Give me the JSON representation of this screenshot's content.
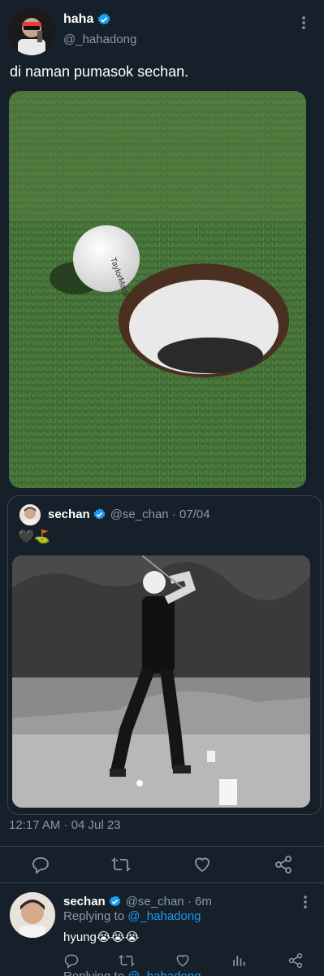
{
  "tweet": {
    "author_name": "haha",
    "author_handle": "@_hahadong",
    "text": "di naman pumasok sechan.",
    "media_alt": "golf ball at the edge of a hole",
    "timestamp": "12:17 AM · 04 Jul 23"
  },
  "quote": {
    "author_name": "sechan",
    "author_handle": "@se_chan",
    "date": "07/04",
    "text": "🖤⛳",
    "media_alt": "black and white photo of golfer mid-swing"
  },
  "reply": {
    "author_name": "sechan",
    "author_handle": "@se_chan",
    "time": "6m",
    "replying_label": "Replying to",
    "replying_handle": "@_hahadong",
    "text": "hyung😭😭😭"
  },
  "next_reply": {
    "replying_label": "Replying to",
    "replying_handle": "@_hahadong"
  },
  "colors": {
    "background": "#15202b",
    "accent": "#1d9bf0",
    "muted": "#8b98a5",
    "border": "#38444d"
  }
}
